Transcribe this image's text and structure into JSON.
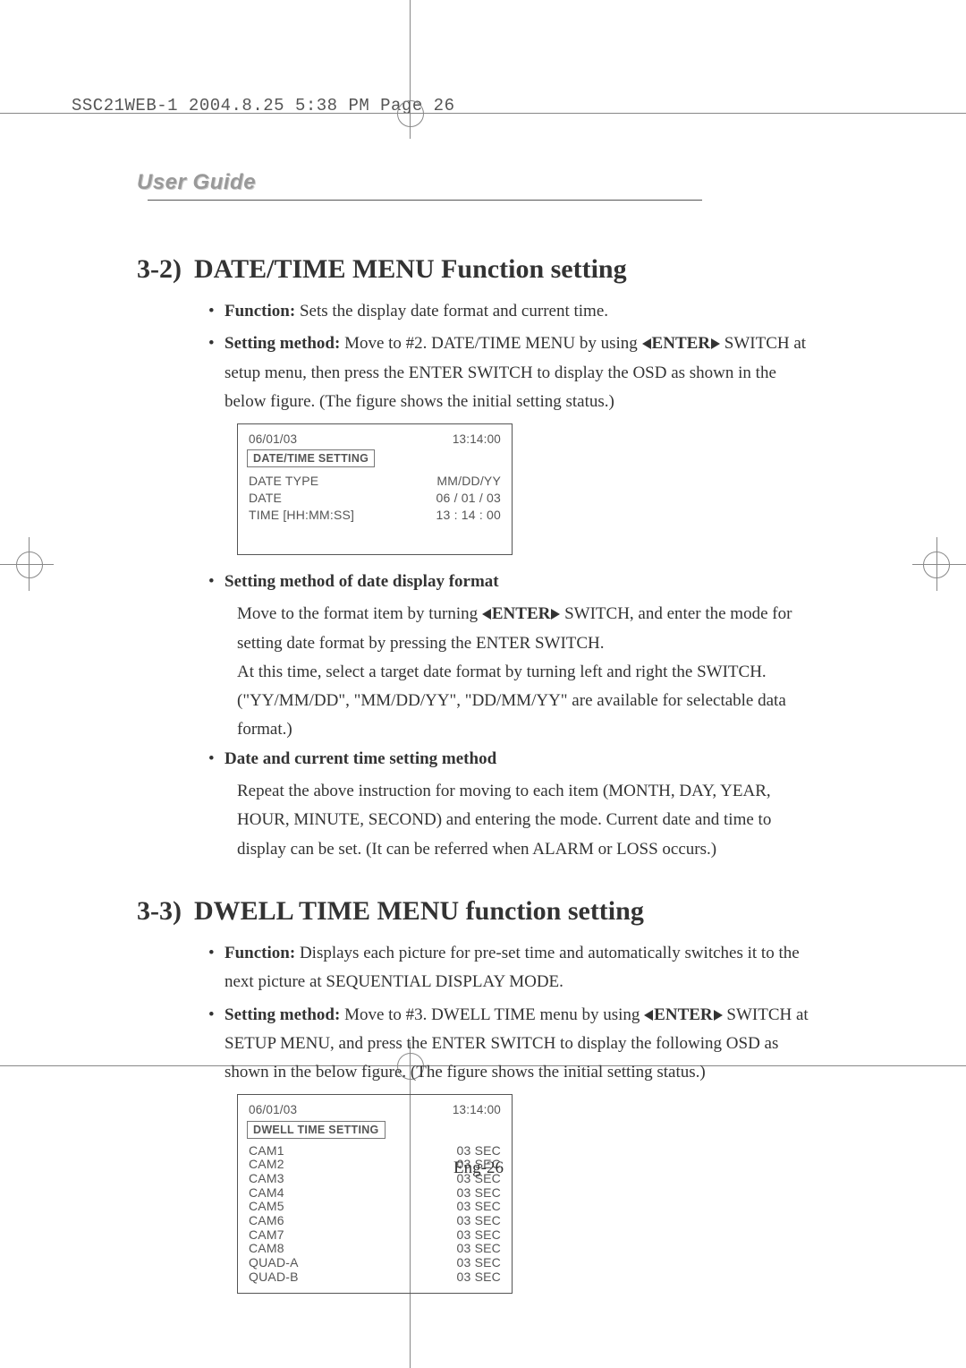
{
  "header": "SSC21WEB-1  2004.8.25  5:38 PM  Page 26",
  "user_guide_label": "User Guide",
  "section32": {
    "number": "3-2)",
    "title": "DATE/TIME MENU Function setting",
    "b1_label": "Function:",
    "b1_text": " Sets the display date format and current time.",
    "b2_label": "Setting method:",
    "b2_text_a": " Move to #2. DATE/TIME MENU by using ",
    "enter": "ENTER",
    "b2_text_b": " SWITCH at setup menu, then press the ENTER SWITCH to display the OSD as shown in the below figure. (The figure shows the initial setting status.)",
    "sub1_label": "Setting method of date display format",
    "sub1_p1_a": "Move to the format item by turning ",
    "sub1_p1_b": " SWITCH, and enter the mode for setting date format by pressing the ENTER SWITCH.",
    "sub1_p2": "At this time, select a target date format by turning left and right the SWITCH.",
    "sub1_p3": "(\"YY/MM/DD\", \"MM/DD/YY\", \"DD/MM/YY\" are available for selectable data format.)",
    "sub2_label": "Date and current time setting method",
    "sub2_p1": "Repeat the above instruction for moving to each item (MONTH, DAY, YEAR, HOUR, MINUTE, SECOND) and entering the mode. Current date and time to display can be set. (It can be referred when ALARM or LOSS occurs.)"
  },
  "osd1": {
    "date": "06/01/03",
    "time": "13:14:00",
    "title": "DATE/TIME  SETTING",
    "rows": [
      {
        "k": "DATE TYPE",
        "v": "MM/DD/YY"
      },
      {
        "k": "DATE",
        "v": "06 / 01 / 03"
      },
      {
        "k": "TIME [HH:MM:SS]",
        "v": "13 : 14 : 00"
      }
    ]
  },
  "section33": {
    "number": "3-3)",
    "title": "DWELL TIME MENU function setting",
    "b1_label": "Function:",
    "b1_text": "  Displays each picture for pre-set time and automatically switches it to the next picture at SEQUENTIAL DISPLAY MODE.",
    "b2_label": "Setting method:",
    "b2_text_a": "  Move to #3. DWELL TIME menu by using ",
    "enter": "ENTER",
    "b2_text_b": " SWITCH at SETUP MENU, and press the ENTER SWITCH to display the following OSD as shown in the below figure. (The figure shows the initial setting status.)"
  },
  "osd2": {
    "date": "06/01/03",
    "time": "13:14:00",
    "title": "DWELL TIME SETTING",
    "rows": [
      {
        "k": "CAM1",
        "v": "03 SEC"
      },
      {
        "k": "CAM2",
        "v": "03 SEC"
      },
      {
        "k": "CAM3",
        "v": "03 SEC"
      },
      {
        "k": "CAM4",
        "v": "03 SEC"
      },
      {
        "k": "CAM5",
        "v": "03 SEC"
      },
      {
        "k": "CAM6",
        "v": "03 SEC"
      },
      {
        "k": "CAM7",
        "v": "03 SEC"
      },
      {
        "k": "CAM8",
        "v": "03 SEC"
      },
      {
        "k": "QUAD-A",
        "v": "03 SEC"
      },
      {
        "k": "QUAD-B",
        "v": "03 SEC"
      }
    ]
  },
  "page_number": "Eng-26"
}
